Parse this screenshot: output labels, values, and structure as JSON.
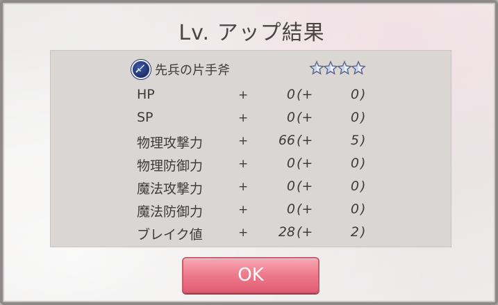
{
  "dialog": {
    "title": "Lv. アップ結果"
  },
  "weapon": {
    "icon": "sword-icon",
    "name": "先兵の片手斧",
    "stars": 4,
    "star_color": "#c9d3ea"
  },
  "stats": [
    {
      "label": "HP",
      "plus": "+",
      "value": "0",
      "open": "(+",
      "bonus": "0",
      "close": ")"
    },
    {
      "label": "SP",
      "plus": "+",
      "value": "0",
      "open": "(+",
      "bonus": "0",
      "close": ")"
    },
    {
      "label": "物理攻撃力",
      "plus": "+",
      "value": "66",
      "open": "(+",
      "bonus": "5",
      "close": ")"
    },
    {
      "label": "物理防御力",
      "plus": "+",
      "value": "0",
      "open": "(+",
      "bonus": "0",
      "close": ")"
    },
    {
      "label": "魔法攻撃力",
      "plus": "+",
      "value": "0",
      "open": "(+",
      "bonus": "0",
      "close": ")"
    },
    {
      "label": "魔法防御力",
      "plus": "+",
      "value": "0",
      "open": "(+",
      "bonus": "0",
      "close": ")"
    },
    {
      "label": "ブレイク値",
      "plus": "+",
      "value": "28",
      "open": "(+",
      "bonus": "2",
      "close": ")"
    }
  ],
  "ok_button": {
    "label": "OK",
    "color": "#ee7a8c"
  }
}
